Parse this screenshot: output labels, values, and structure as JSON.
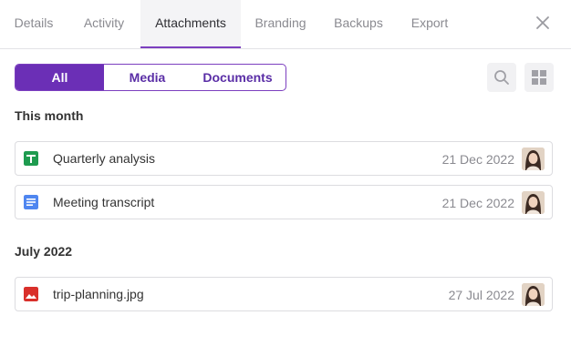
{
  "tabs": [
    {
      "label": "Details"
    },
    {
      "label": "Activity"
    },
    {
      "label": "Attachments",
      "active": true
    },
    {
      "label": "Branding"
    },
    {
      "label": "Backups"
    },
    {
      "label": "Export"
    }
  ],
  "close_icon": "close-icon",
  "filters": {
    "all": "All",
    "media": "Media",
    "documents": "Documents",
    "selected": "All"
  },
  "tools": {
    "search_icon": "search-icon",
    "grid_icon": "grid-view-icon"
  },
  "colors": {
    "accent": "#6b2fb6",
    "sheet_icon": "#1e9b4f",
    "doc_icon": "#4f86f0",
    "image_icon": "#d9302b"
  },
  "sections": [
    {
      "title": "This month",
      "files": [
        {
          "name": "Quarterly analysis",
          "date": "21 Dec 2022",
          "icon": "spreadsheet-icon"
        },
        {
          "name": "Meeting transcript",
          "date": "21 Dec 2022",
          "icon": "document-icon"
        }
      ]
    },
    {
      "title": "July 2022",
      "files": [
        {
          "name": "trip-planning.jpg",
          "date": "27 Jul 2022",
          "icon": "image-icon"
        }
      ]
    }
  ]
}
